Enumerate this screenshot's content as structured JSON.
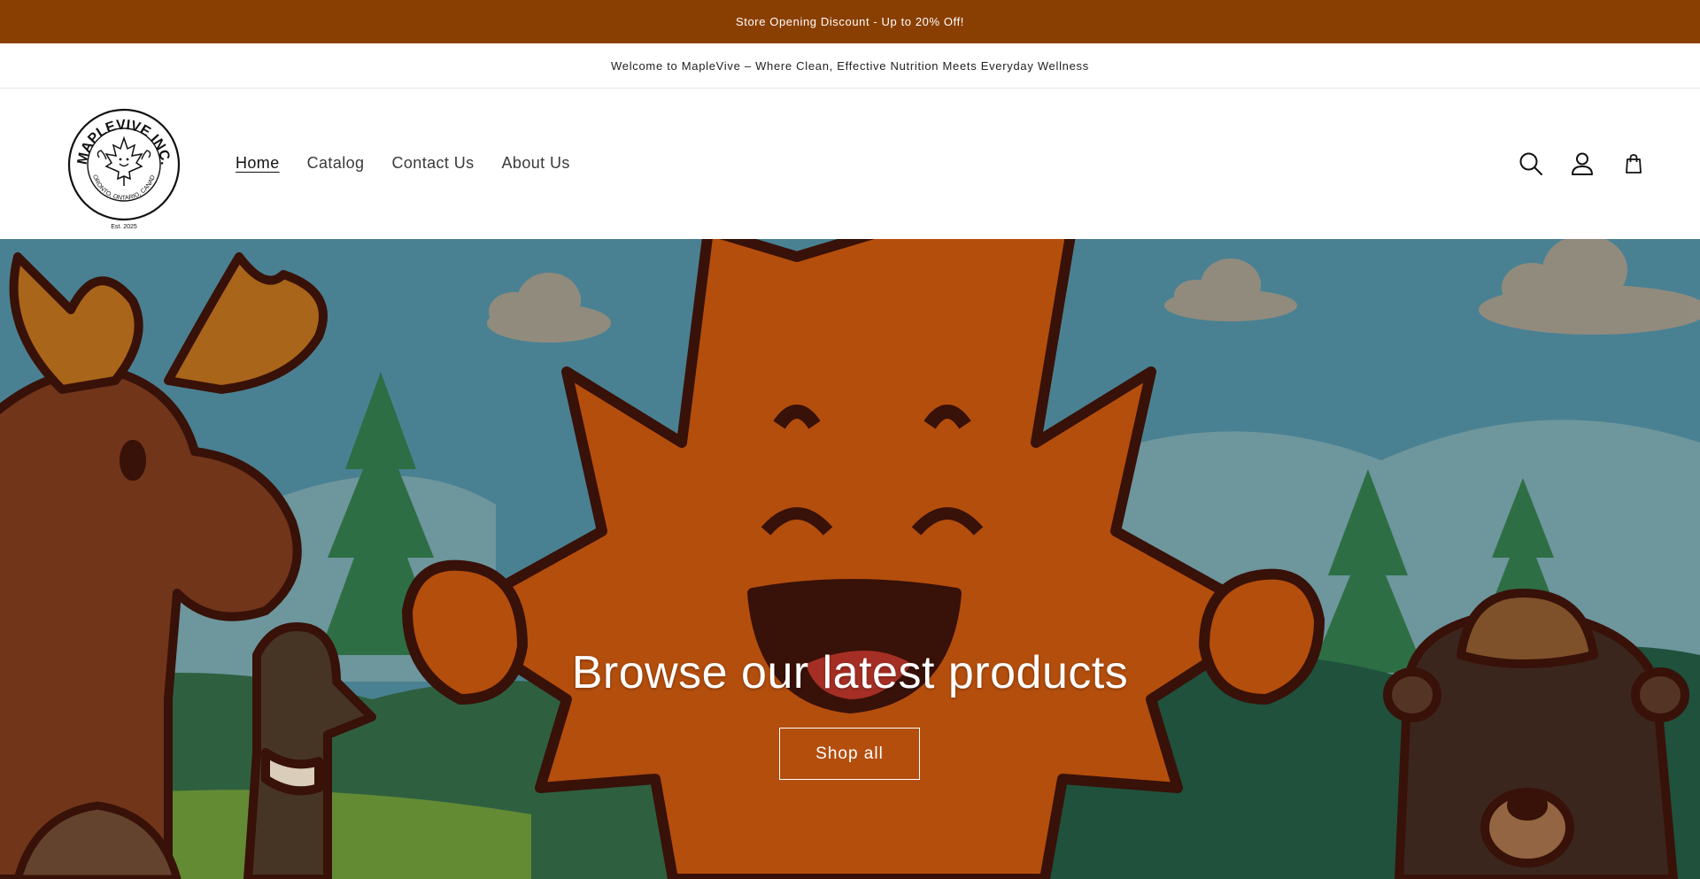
{
  "announcement": {
    "promo_text": "Store Opening Discount - Up to 20% Off!",
    "welcome_text": "Welcome to MapleVive – Where Clean, Effective Nutrition Meets Everyday Wellness"
  },
  "logo": {
    "name": "MAPLEVIVE INC.",
    "location": "TORONTO, ONTARIO, CANADA",
    "est": "Est. 2025"
  },
  "nav": {
    "items": [
      {
        "label": "Home",
        "active": true
      },
      {
        "label": "Catalog"
      },
      {
        "label": "Contact Us"
      },
      {
        "label": "About Us"
      }
    ]
  },
  "header_icons": [
    "search-icon",
    "account-icon",
    "cart-icon"
  ],
  "hero": {
    "title": "Browse our latest products",
    "button_label": "Shop all"
  },
  "colors": {
    "promo_bg": "#8a3f02",
    "hero_sky": "#4f8fa3",
    "leaf": "#c4560f",
    "outline": "#3a120a"
  }
}
